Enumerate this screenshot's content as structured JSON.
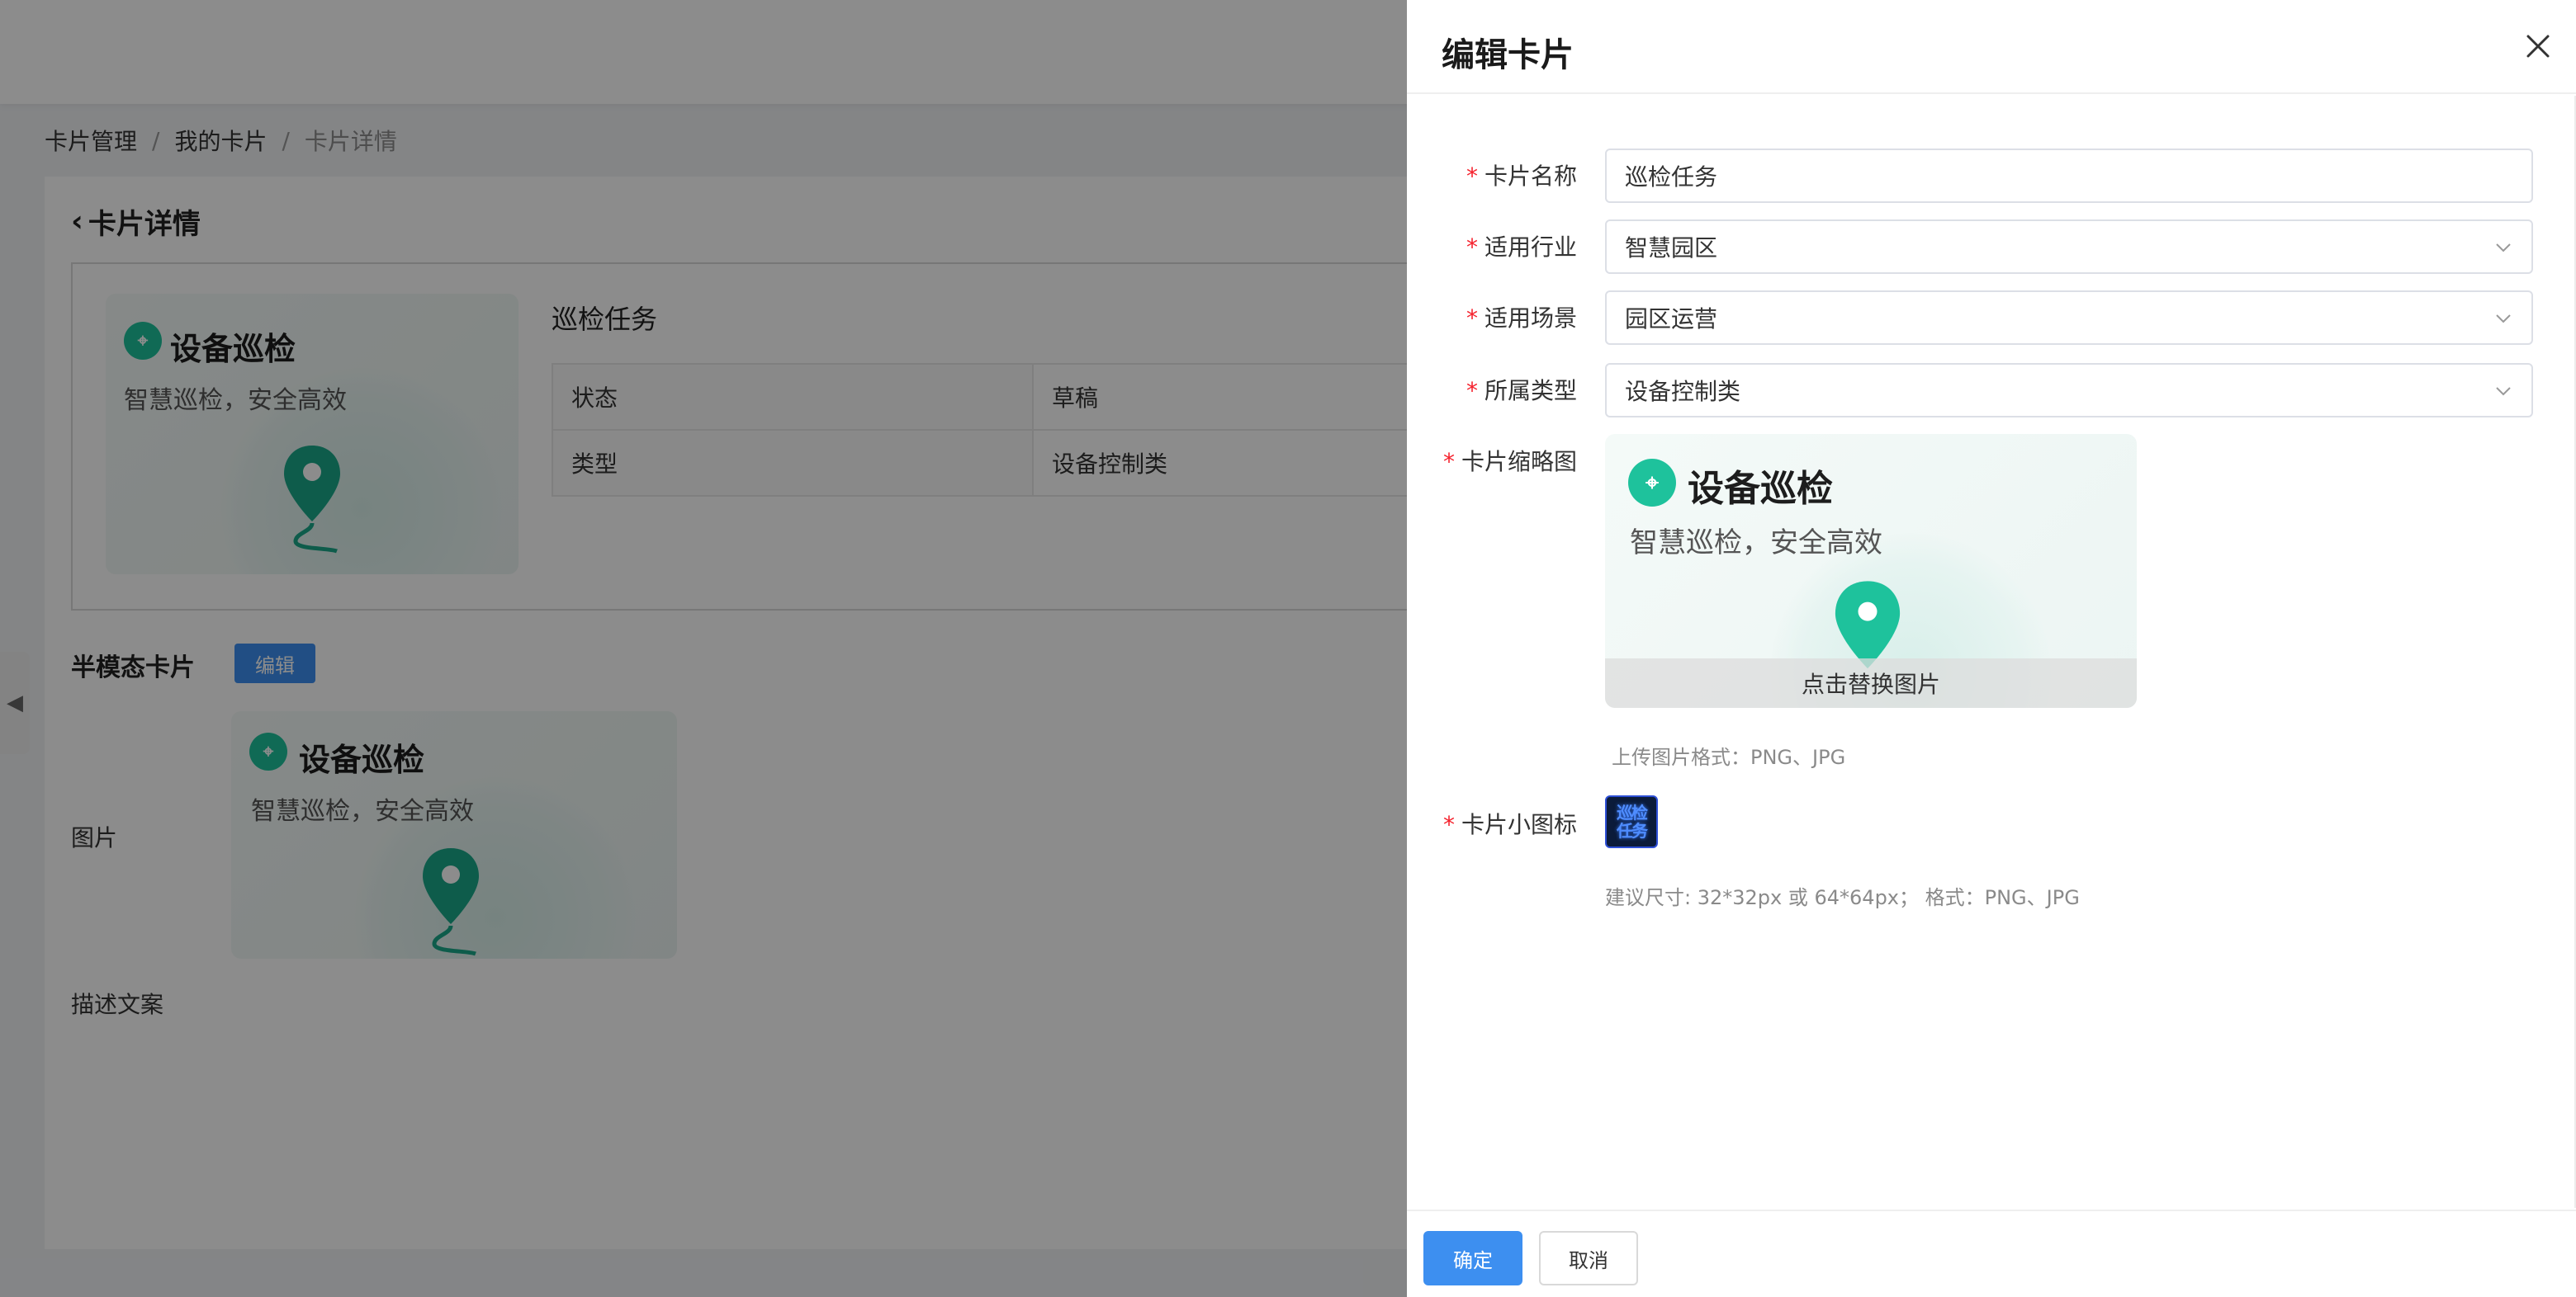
{
  "breadcrumb": {
    "items": [
      "卡片管理",
      "我的卡片",
      "卡片详情"
    ],
    "separator": "/"
  },
  "page": {
    "title": "卡片详情"
  },
  "detail": {
    "card_name": "巡检任务",
    "table": [
      {
        "key": "状态",
        "value": "草稿"
      },
      {
        "key": "类型",
        "value": "设备控制类"
      }
    ]
  },
  "thumbnail": {
    "title": "设备巡检",
    "subtitle": "智慧巡检，安全高效"
  },
  "half_modal": {
    "title": "半模态卡片",
    "edit_label": "编辑",
    "image_label": "图片",
    "desc_label": "描述文案"
  },
  "drawer": {
    "title": "编辑卡片",
    "fields": {
      "card_name": {
        "label": "卡片名称",
        "value": "巡检任务"
      },
      "industry": {
        "label": "适用行业",
        "value": "智慧园区"
      },
      "scene": {
        "label": "适用场景",
        "value": "园区运营"
      },
      "type": {
        "label": "所属类型",
        "value": "设备控制类"
      },
      "thumbnail": {
        "label": "卡片缩略图",
        "replace_label": "点击替换图片",
        "hint": "上传图片格式：PNG、JPG"
      },
      "icon": {
        "label": "卡片小图标",
        "icon_text_1": "巡检",
        "icon_text_2": "任务",
        "hint": "建议尺寸: 32*32px 或 64*64px； 格式：PNG、JPG"
      }
    },
    "required_mark": "*",
    "confirm_label": "确定",
    "cancel_label": "取消"
  },
  "colors": {
    "primary": "#3d8ff0",
    "required": "#f5222d",
    "teal": "#1ec29c",
    "mask": "rgba(0,0,0,0.45)"
  }
}
